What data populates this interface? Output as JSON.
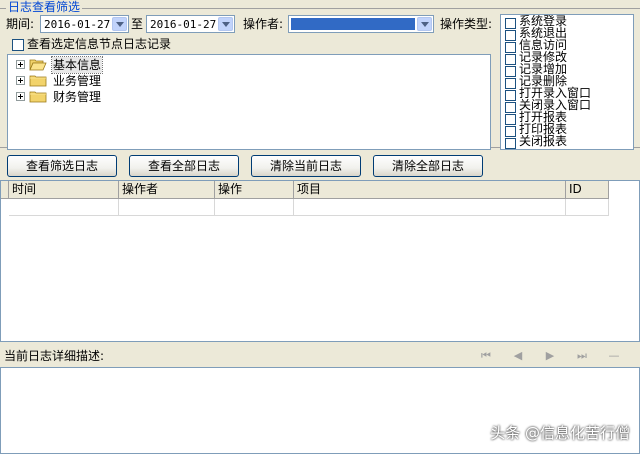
{
  "filter": {
    "title": "日志查看筛选",
    "period_label": "期间:",
    "date_from": "2016-01-27",
    "to_label": "至",
    "date_to": "2016-01-27",
    "operator_label": "操作者:",
    "operator_value": "",
    "optype_label": "操作类型:",
    "node_checkbox_label": "查看选定信息节点日志记录"
  },
  "tree": {
    "items": [
      {
        "label": "基本信息",
        "expanded": true
      },
      {
        "label": "业务管理",
        "expanded": false
      },
      {
        "label": "财务管理",
        "expanded": false
      }
    ]
  },
  "op_types": [
    "系统登录",
    "系统退出",
    "信息访问",
    "记录修改",
    "记录增加",
    "记录删除",
    "打开录入窗口",
    "关闭录入窗口",
    "打开报表",
    "打印报表",
    "关闭报表"
  ],
  "buttons": {
    "view_filtered": "查看筛选日志",
    "view_all": "查看全部日志",
    "clear_current": "清除当前日志",
    "clear_all": "清除全部日志"
  },
  "grid": {
    "columns": [
      "时间",
      "操作者",
      "操作",
      "项目",
      "ID"
    ]
  },
  "detail": {
    "label": "当前日志详细描述:"
  },
  "watermark": "头条 @信息化苦行僧",
  "colors": {
    "accent": "#0046d5",
    "selection": "#316ac5"
  }
}
